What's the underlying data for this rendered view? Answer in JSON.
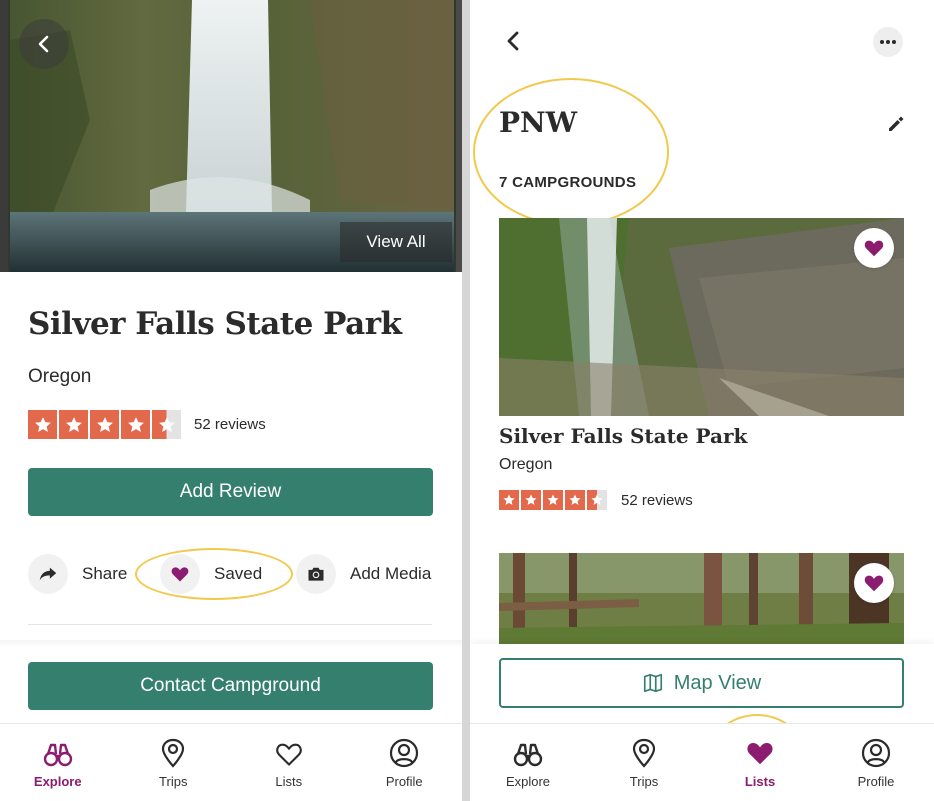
{
  "colors": {
    "brand_green": "#357f6e",
    "brand_purple": "#8c1c6f",
    "star": "#e2694b",
    "highlight": "#f2c94c"
  },
  "detail": {
    "back_icon": "chevron-left-icon",
    "gallery_link": "View All",
    "park_name": "Silver Falls State Park",
    "state": "Oregon",
    "rating": 4.5,
    "reviews": "52 reviews",
    "add_review": "Add Review",
    "actions": {
      "share": "Share",
      "saved": "Saved",
      "add_media": "Add Media"
    },
    "contact": "Contact Campground",
    "tabs": [
      {
        "label": "Explore",
        "icon": "binoculars-icon",
        "active": true
      },
      {
        "label": "Trips",
        "icon": "map-pin-icon",
        "active": false
      },
      {
        "label": "Lists",
        "icon": "heart-outline-icon",
        "active": false
      },
      {
        "label": "Profile",
        "icon": "user-circle-icon",
        "active": false
      }
    ]
  },
  "list": {
    "title": "PNW",
    "count": "7 CAMPGROUNDS",
    "card": {
      "name": "Silver Falls State Park",
      "state": "Oregon",
      "rating": 4.5,
      "reviews": "52 reviews"
    },
    "map_view": "Map View",
    "tabs": [
      {
        "label": "Explore",
        "icon": "binoculars-icon",
        "active": false
      },
      {
        "label": "Trips",
        "icon": "map-pin-icon",
        "active": false
      },
      {
        "label": "Lists",
        "icon": "heart-filled-icon",
        "active": true
      },
      {
        "label": "Profile",
        "icon": "user-circle-icon",
        "active": false
      }
    ]
  }
}
